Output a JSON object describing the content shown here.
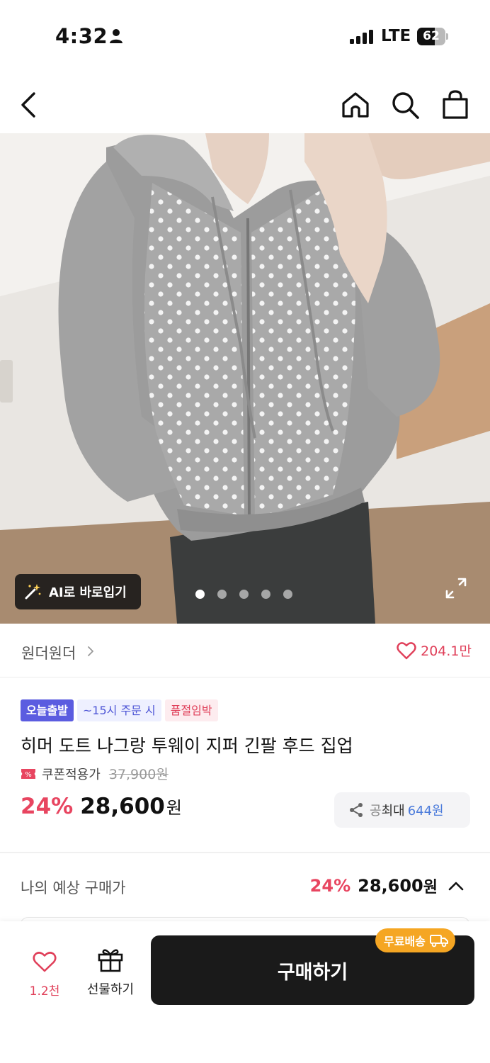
{
  "status_bar": {
    "time": "4:32",
    "network": "LTE",
    "battery_level": "62",
    "battery_fraction": 0.62
  },
  "nav": {
    "icons": [
      "back-arrow-icon",
      "home-icon",
      "search-icon",
      "shopping-bag-icon"
    ]
  },
  "gallery": {
    "ai_button_label": "AI로 바로입기",
    "slide_count": 5,
    "active_slide": 1
  },
  "brand": {
    "name": "원더원더",
    "like_count": "204.1만"
  },
  "product": {
    "tags": {
      "today_ship": "오늘출발",
      "order_cutoff": "~15시 주문 시",
      "low_stock": "품절임박"
    },
    "title": "히머 도트 나그랑 투웨이 지퍼 긴팔 후드 집업",
    "coupon_label": "쿠폰적용가",
    "original_price": "37,900원",
    "discount": "24%",
    "price": "28,600",
    "price_unit": "원",
    "share": {
      "prefix": "공",
      "label": "최대",
      "amount": "644원"
    }
  },
  "estimate": {
    "label": "나의 예상 구매가",
    "discount": "24%",
    "price": "28,600",
    "unit": "원"
  },
  "bottom_bar": {
    "like_count": "1.2천",
    "gift_label": "선물하기",
    "buy_label": "구매하기",
    "free_shipping_label": "무료배송"
  },
  "colors": {
    "accent_red": "#e84560",
    "badge_purple": "#5b5ce0",
    "free_ship_orange": "#f5a623",
    "buy_button": "#1a1a1a"
  }
}
